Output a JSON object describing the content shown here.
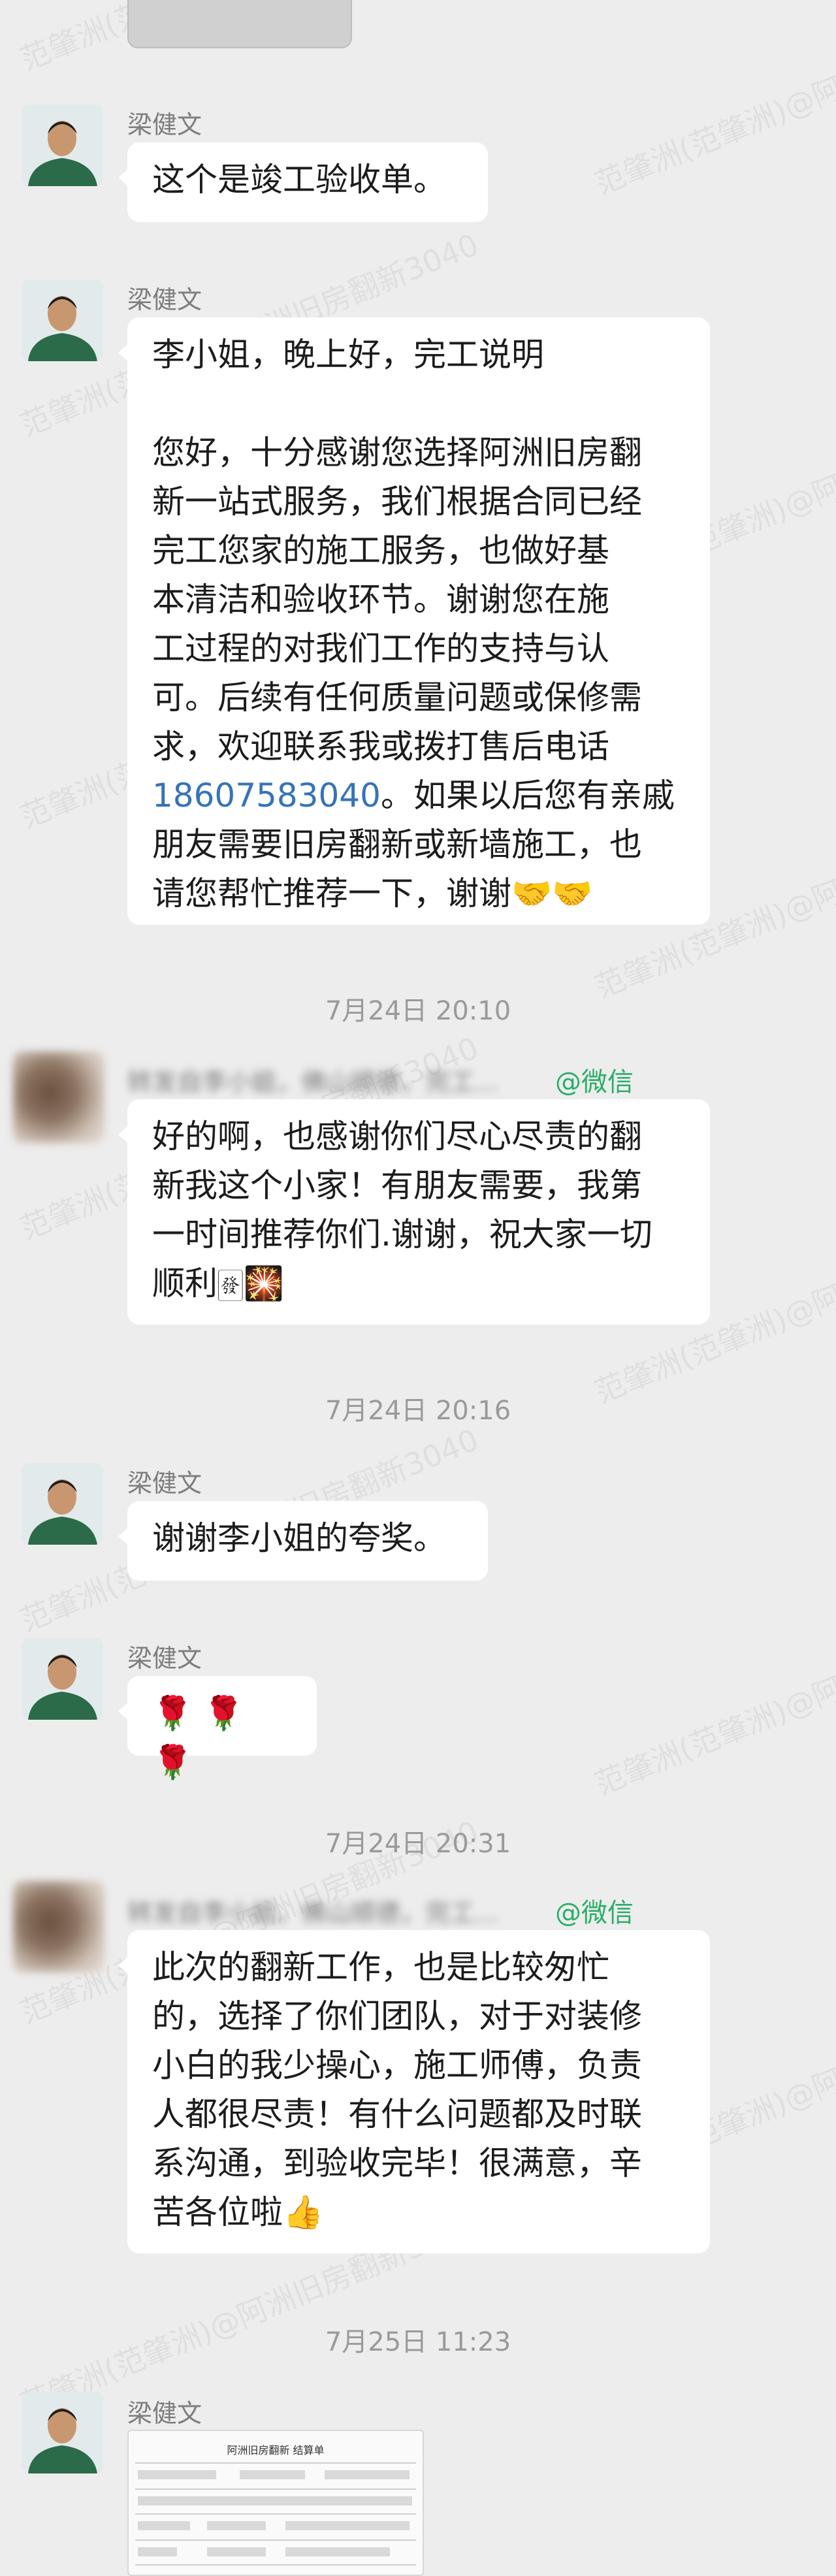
{
  "messages": [
    {
      "sender": "梁健文",
      "text": "这个是竣工验收单。"
    },
    {
      "sender": "梁健文",
      "lines": [
        "李小姐，晚上好，完工说明",
        "",
        "您好，十分感谢您选择阿洲旧房翻",
        "新一站式服务，我们根据合同已经",
        "完工您家的施工服务，也做好基",
        "本清洁和验收环节。谢谢您在施",
        "工过程的对我们工作的支持与认",
        "可。后续有任何质量问题或保修需",
        "求，欢迎联系我或拨打售后电话"
      ],
      "phone": "18607583040",
      "after_phone": "。如果以后您有亲戚",
      "tail_lines": [
        "朋友需要旧房翻新或新墙施工，也",
        "请您帮忙推荐一下，谢谢🤝🤝"
      ]
    },
    {
      "time": "7月24日 20:10"
    },
    {
      "sender_blurred": "转发自李小姐，佛山顺德，完工...",
      "source": "@微信",
      "lines": [
        "好的啊，也感谢你们尽心尽责的翻",
        "新我这个小家！有朋友需要，我第",
        "一时间推荐你们.谢谢，祝大家一切",
        "顺利🀅🎇"
      ]
    },
    {
      "time": "7月24日 20:16"
    },
    {
      "sender": "梁健文",
      "text": "谢谢李小姐的夸奖。"
    },
    {
      "sender": "梁健文",
      "text": "🌹 🌹 🌹"
    },
    {
      "time": "7月24日 20:31"
    },
    {
      "sender_blurred": "转发自李小姐，佛山顺德，完工...",
      "source": "@微信",
      "lines": [
        "此次的翻新工作，也是比较匆忙",
        "的，选择了你们团队，对于对装修",
        "小白的我少操心，施工师傅，负责",
        "人都很尽责！有什么问题都及时联",
        "系沟通，到验收完毕！很满意，辛",
        "苦各位啦👍"
      ]
    },
    {
      "time": "7月25日 11:23"
    },
    {
      "sender": "梁健文",
      "doc_title": "阿洲旧房翻新 结算单"
    }
  ],
  "watermark": "范肇洲(范肇洲)@阿洲旧房翻新3040"
}
